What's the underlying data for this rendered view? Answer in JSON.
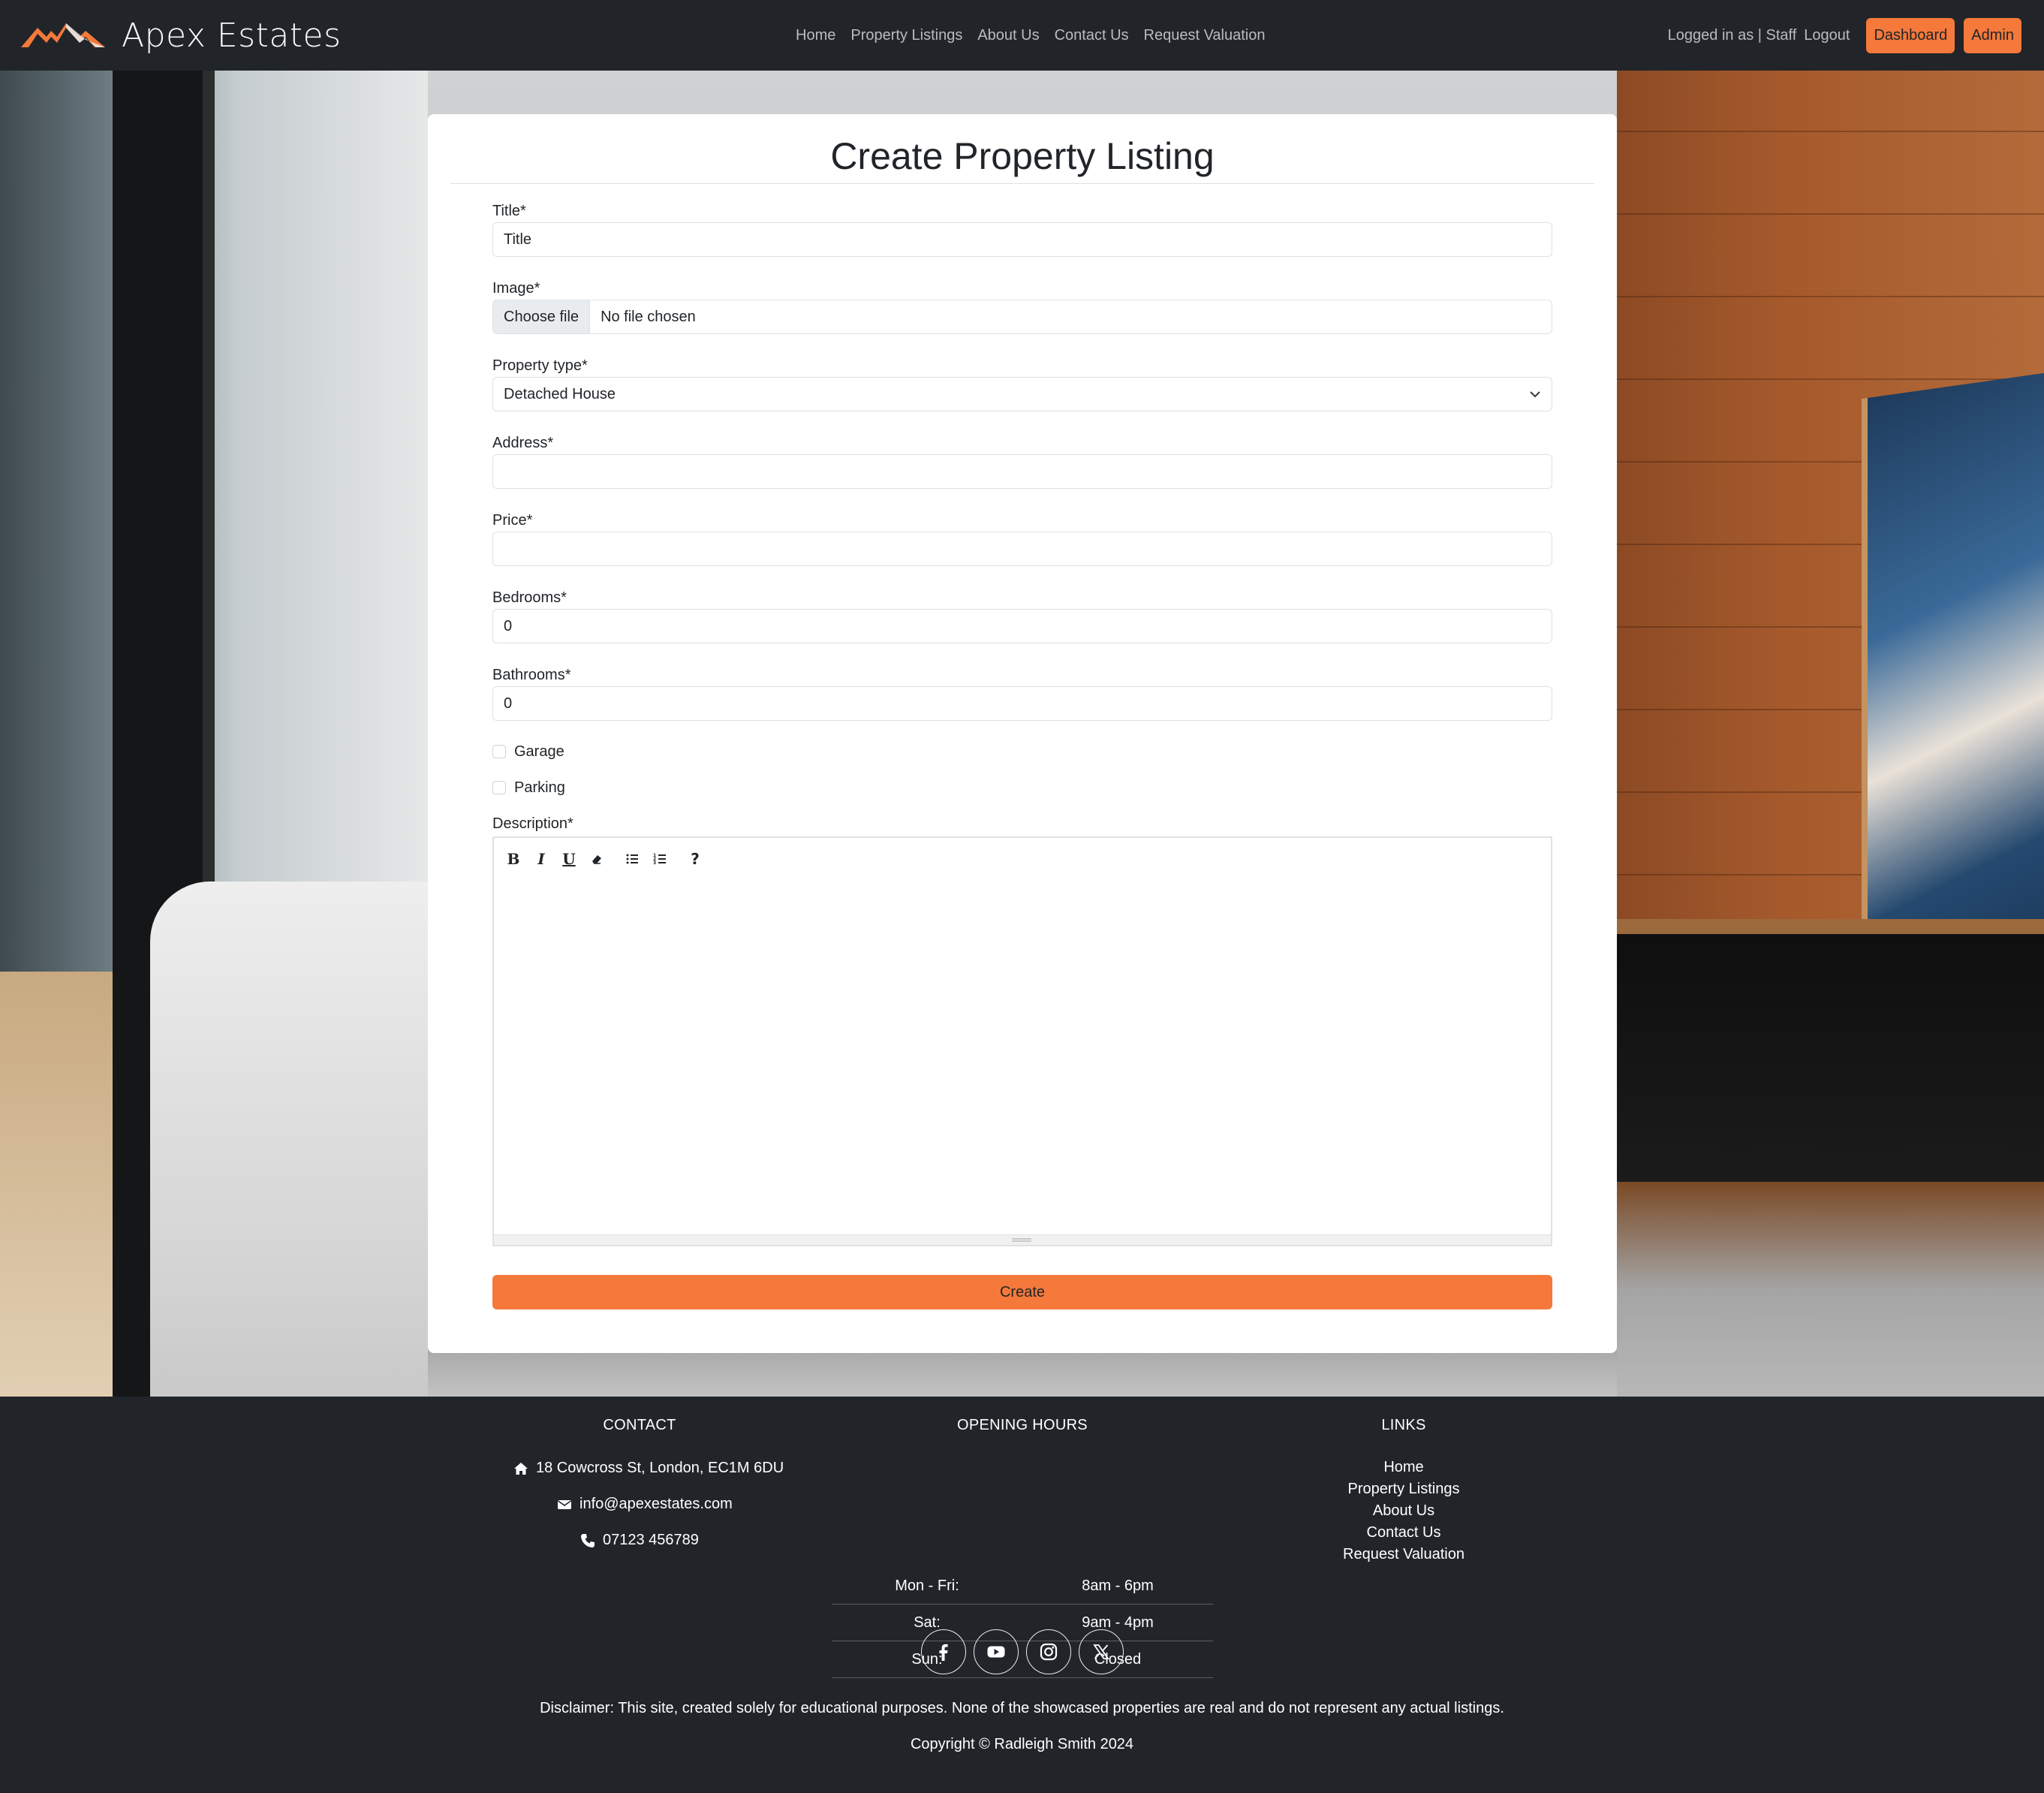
{
  "brand": {
    "name": "Apex Estates",
    "logo_icon": "mountain-logo-icon",
    "accent": "#f4793a"
  },
  "nav": {
    "links": [
      "Home",
      "Property Listings",
      "About Us",
      "Contact Us",
      "Request Valuation"
    ],
    "status": "Logged in as | Staff",
    "logout": "Logout",
    "dashboard": "Dashboard",
    "admin": "Admin"
  },
  "form": {
    "heading": "Create Property Listing",
    "title": {
      "label": "Title*",
      "value": "Title"
    },
    "image": {
      "label": "Image*",
      "button": "Choose file",
      "status": "No file chosen"
    },
    "property_type": {
      "label": "Property type*",
      "value": "Detached House"
    },
    "address": {
      "label": "Address*",
      "value": ""
    },
    "price": {
      "label": "Price*",
      "value": ""
    },
    "bedrooms": {
      "label": "Bedrooms*",
      "value": "0"
    },
    "bathrooms": {
      "label": "Bathrooms*",
      "value": "0"
    },
    "garage": {
      "label": "Garage",
      "checked": false
    },
    "parking": {
      "label": "Parking",
      "checked": false
    },
    "description": {
      "label": "Description*",
      "toolbar": {
        "bold": "B",
        "italic": "I",
        "underline": "U",
        "help": "?"
      }
    },
    "submit": "Create"
  },
  "footer": {
    "contact": {
      "heading": "CONTACT",
      "address": "18 Cowcross St, London, EC1M 6DU",
      "email": "info@apexestates.com",
      "phone": "07123 456789"
    },
    "hours": {
      "heading": "OPENING HOURS",
      "rows": [
        {
          "day": "Mon - Fri:",
          "time": "8am - 6pm"
        },
        {
          "day": "Sat:",
          "time": "9am - 4pm"
        },
        {
          "day": "Sun:",
          "time": "Closed"
        }
      ]
    },
    "links": {
      "heading": "LINKS",
      "items": [
        "Home",
        "Property Listings",
        "About Us",
        "Contact Us",
        "Request Valuation"
      ]
    },
    "social": [
      "facebook-icon",
      "youtube-icon",
      "instagram-icon",
      "x-icon"
    ],
    "disclaimer": "Disclaimer: This site, created solely for educational purposes. None of the showcased properties are real and do not represent any actual listings.",
    "copyright": "Copyright © Radleigh Smith 2024"
  }
}
